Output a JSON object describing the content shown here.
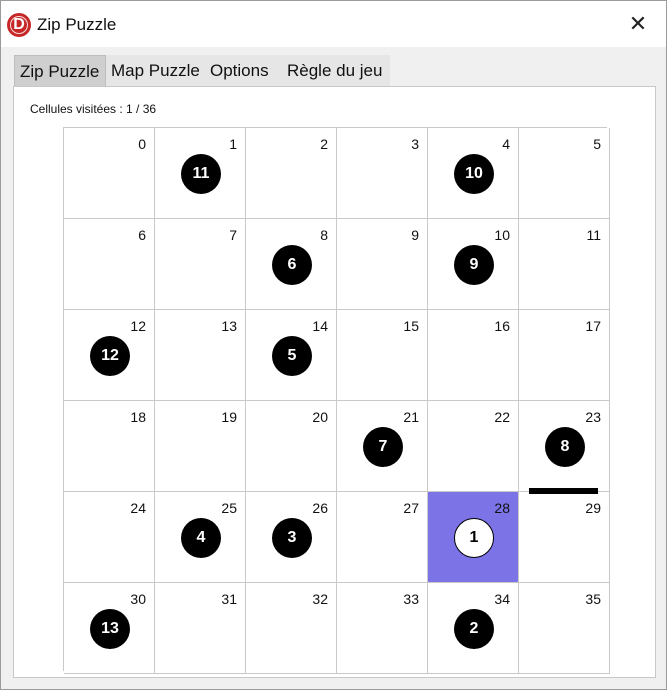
{
  "window": {
    "title": "Zip Puzzle",
    "icon": "app-logo-icon",
    "close_glyph": "✕"
  },
  "tabs": [
    {
      "label": "Zip Puzzle",
      "active": true
    },
    {
      "label": "Map Puzzle",
      "active": false
    },
    {
      "label": "Options",
      "active": false
    },
    {
      "label": "Règle du jeu",
      "active": false
    }
  ],
  "status": {
    "text": "Cellules visitées : 1 / 36"
  },
  "colors": {
    "visited": "#7b73e6",
    "waypoint": "#000000",
    "wall": "#000000"
  },
  "board": {
    "rows": 6,
    "cols": 6,
    "visited_cells": [
      28
    ],
    "walls": [
      {
        "between": [
          23,
          29
        ],
        "side": "horizontal"
      }
    ],
    "waypoints": [
      {
        "cell": 28,
        "number": 1,
        "start": true
      },
      {
        "cell": 34,
        "number": 2
      },
      {
        "cell": 26,
        "number": 3
      },
      {
        "cell": 25,
        "number": 4
      },
      {
        "cell": 14,
        "number": 5
      },
      {
        "cell": 8,
        "number": 6
      },
      {
        "cell": 21,
        "number": 7
      },
      {
        "cell": 23,
        "number": 8
      },
      {
        "cell": 10,
        "number": 9
      },
      {
        "cell": 4,
        "number": 10
      },
      {
        "cell": 1,
        "number": 11
      },
      {
        "cell": 12,
        "number": 12
      },
      {
        "cell": 30,
        "number": 13
      }
    ]
  }
}
